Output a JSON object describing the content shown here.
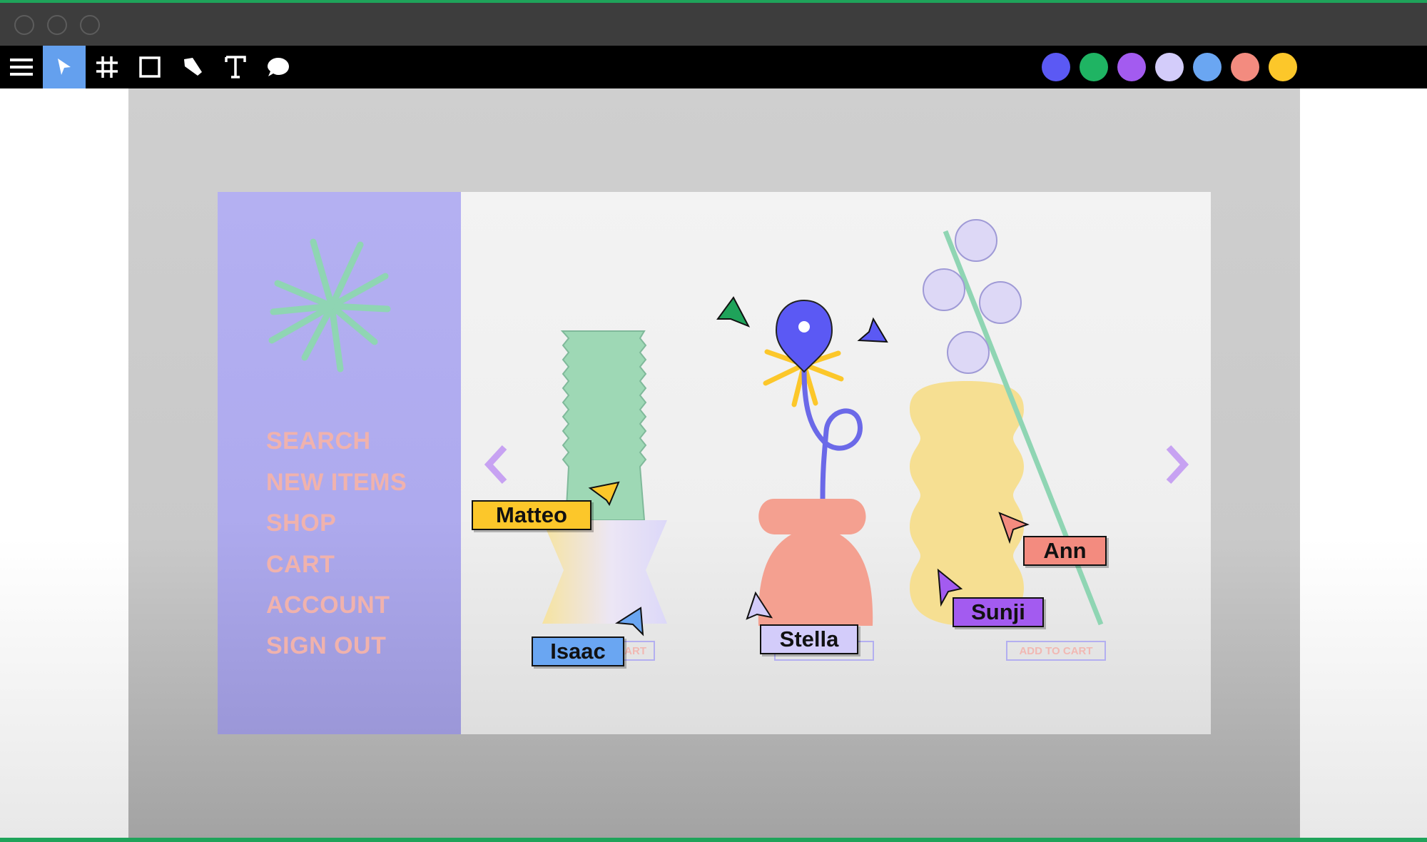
{
  "window": {
    "traffic_lights": [
      "close",
      "minimize",
      "zoom"
    ]
  },
  "toolbar": {
    "menu_icon": "hamburger-menu-icon",
    "tools": [
      {
        "name": "move",
        "icon": "cursor-arrow-icon",
        "active": true
      },
      {
        "name": "frame",
        "icon": "hash-frame-icon",
        "active": false
      },
      {
        "name": "rectangle",
        "icon": "square-icon",
        "active": false
      },
      {
        "name": "pen",
        "icon": "pen-nib-icon",
        "active": false
      },
      {
        "name": "text",
        "icon": "text-t-icon",
        "active": false
      },
      {
        "name": "comment",
        "icon": "speech-bubble-icon",
        "active": false
      }
    ],
    "colors": [
      "#5b59f4",
      "#1fb463",
      "#a35bf0",
      "#d3ccfa",
      "#6aa6f2",
      "#f38b7f",
      "#fcc72a"
    ]
  },
  "shop": {
    "menu": [
      "SEARCH",
      "NEW ITEMS",
      "SHOP",
      "CART",
      "ACCOUNT",
      "SIGN OUT"
    ],
    "add_to_cart": [
      "ART",
      "ADD TO CART"
    ]
  },
  "collaborators": [
    {
      "name": "Matteo",
      "color": "#fcc72a"
    },
    {
      "name": "Isaac",
      "color": "#6aa6f2"
    },
    {
      "name": "Stella",
      "color": "#d3ccfa"
    },
    {
      "name": "Ann",
      "color": "#f38b7f"
    },
    {
      "name": "Sunji",
      "color": "#a35bf0"
    }
  ],
  "extra_cursor_colors": [
    "#1fa35a",
    "#5b59f4"
  ]
}
